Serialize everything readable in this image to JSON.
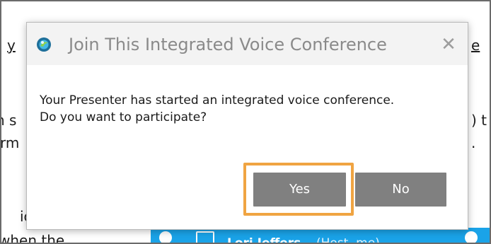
{
  "background": {
    "line_1": "y",
    "line_1_right": "e",
    "line_2_left": "n s",
    "line_2_right": ") t",
    "line_3_left": "rm",
    "line_3_right": ".",
    "line_4_left": "ic",
    "line_5_left": "when the",
    "participant_name": "Lori Jeffers",
    "participant_note": "(Host, me)"
  },
  "dialog": {
    "title": "Join This Integrated Voice Conference",
    "close_symbol": "✕",
    "message_line_1": "Your Presenter has started an integrated voice conference.",
    "message_line_2": "Do you want to participate?",
    "yes_label": "Yes",
    "no_label": "No"
  },
  "colors": {
    "button": "#808080",
    "highlight": "#f0a442",
    "titlebar": "#f3f3f3",
    "participant_bar": "#1aa3e8"
  }
}
